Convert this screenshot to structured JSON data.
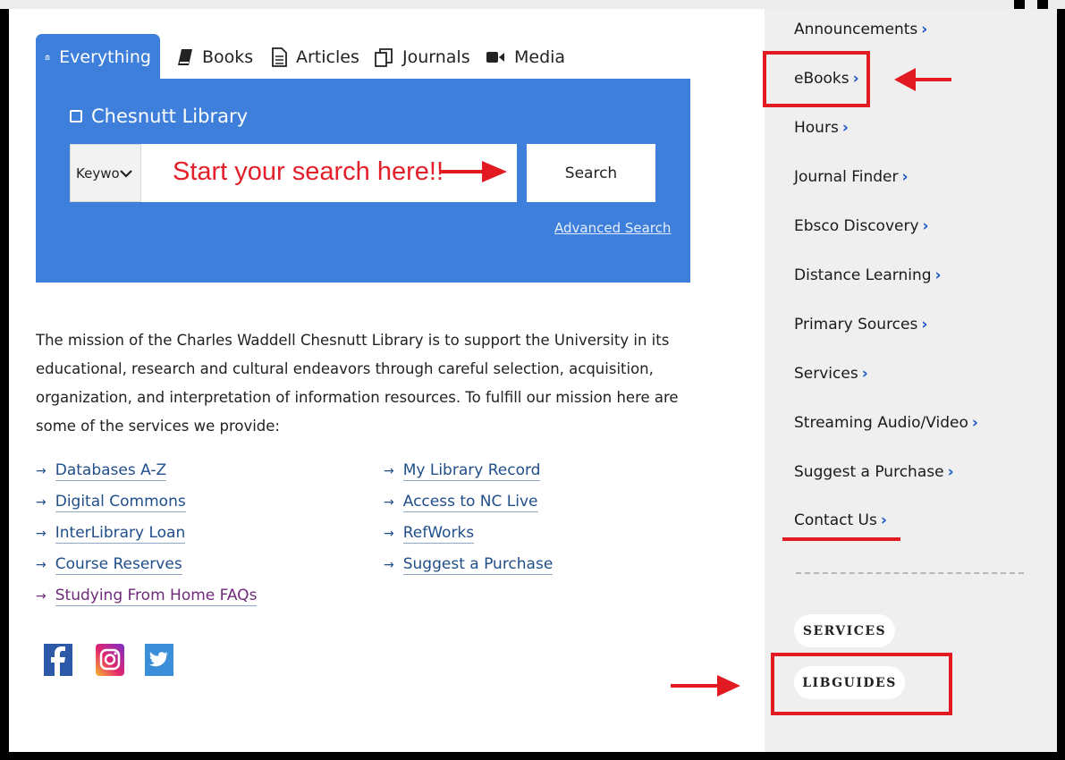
{
  "tabs": [
    {
      "label": "Everything",
      "icon": "institution-icon"
    },
    {
      "label": "Books",
      "icon": "book-icon"
    },
    {
      "label": "Articles",
      "icon": "document-icon"
    },
    {
      "label": "Journals",
      "icon": "journals-icon"
    },
    {
      "label": "Media",
      "icon": "video-camera-icon"
    }
  ],
  "search": {
    "scope_label": "Chesnutt Library",
    "keyword_select": "Keywo",
    "annotation": "Start your search here!!",
    "button": "Search",
    "advanced": "Advanced Search"
  },
  "mission": "The mission of the Charles Waddell Chesnutt Library is to support the University in its educational, research and cultural endeavors through careful selection, acquisition, organization, and interpretation of information resources. To fulfill our mission here are some of the services we provide:",
  "links_left": [
    "Databases A-Z",
    "Digital Commons",
    "InterLibrary Loan",
    "Course Reserves",
    "Studying From Home FAQs"
  ],
  "links_right": [
    "My Library Record",
    "Access to NC Live",
    "RefWorks",
    "Suggest a Purchase"
  ],
  "social": [
    "facebook-icon",
    "instagram-icon",
    "twitter-icon"
  ],
  "sidebar": {
    "items": [
      "Announcements",
      "eBooks",
      "Hours",
      "Journal Finder",
      "Ebsco Discovery",
      "Distance Learning",
      "Primary Sources",
      "Services",
      "Streaming Audio/Video",
      "Suggest a Purchase",
      "Contact Us"
    ],
    "pills": [
      "SERVICES",
      "LIBGUIDES"
    ]
  },
  "colors": {
    "panel_blue": "#3d7fdb",
    "annotation_red": "#e21b23",
    "link_blue": "#1f4e8a",
    "chevron_blue": "#1d58c9"
  }
}
